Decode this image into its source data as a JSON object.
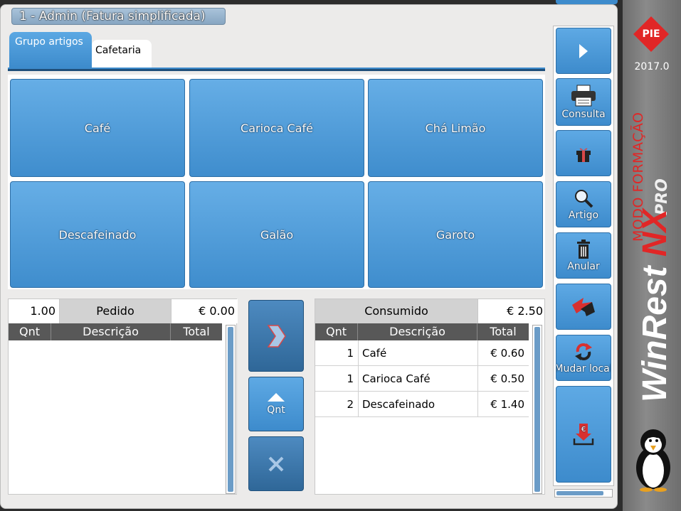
{
  "window": {
    "title": "1 - Admin (Fatura simplificada)"
  },
  "tabs": [
    {
      "label": "Grupo artigos"
    },
    {
      "label": "Cafetaria"
    }
  ],
  "products": [
    {
      "label": "Café"
    },
    {
      "label": "Carioca Café"
    },
    {
      "label": "Chá Limão"
    },
    {
      "label": "Descafeinado"
    },
    {
      "label": "Galão"
    },
    {
      "label": "Garoto"
    }
  ],
  "order": {
    "quantity": "1.00",
    "label": "Pedido",
    "total": "€ 0.00",
    "columns": [
      "Qnt",
      "Descrição",
      "Total"
    ]
  },
  "middle": {
    "qty_label": "Qnt"
  },
  "consumed": {
    "label": "Consumido",
    "total": "€ 2.50",
    "columns": [
      "Qnt",
      "Descrição",
      "Total"
    ],
    "rows": [
      {
        "qty": "1",
        "desc": "Café",
        "total": "€ 0.60"
      },
      {
        "qty": "1",
        "desc": "Carioca Café",
        "total": "€ 0.50"
      },
      {
        "qty": "2",
        "desc": "Descafeinado",
        "total": "€ 1.40"
      }
    ]
  },
  "side": {
    "consulta": "Consulta",
    "artigo": "Artigo",
    "anular": "Anular",
    "mudar": "Mudar local"
  },
  "brand": {
    "logo": "PIE",
    "version": "2017.0",
    "mode": "MODO FORMAÇÃO",
    "product_win": "WinRest",
    "product_nx": "NX",
    "product_pro": "PRO",
    "accent_color": "#e12626",
    "button_color": "#3d8bcc"
  }
}
